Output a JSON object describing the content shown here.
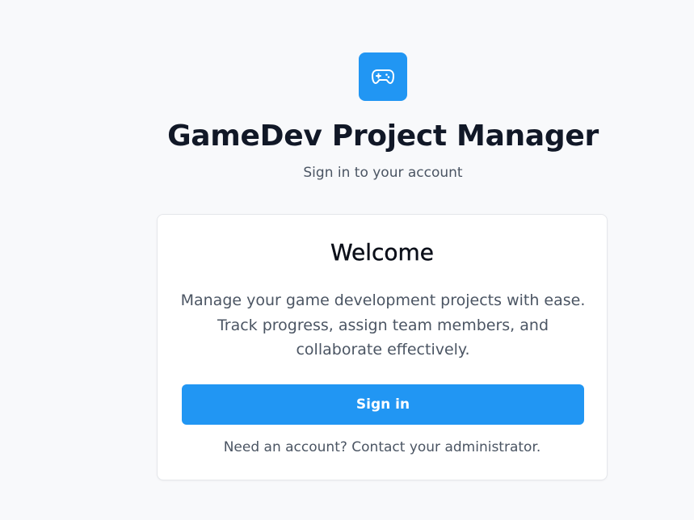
{
  "header": {
    "logo_icon": "gamepad-icon",
    "title": "GameDev Project Manager",
    "subtitle": "Sign in to your account"
  },
  "card": {
    "title": "Welcome",
    "description": "Manage your game development projects with ease. Track progress, assign team members, and collaborate effectively.",
    "signin_label": "Sign in",
    "help_text": "Need an account? Contact your administrator."
  },
  "colors": {
    "accent": "#2196f3",
    "background": "#f8f9fb",
    "card": "#ffffff",
    "text_primary": "#111827",
    "text_secondary": "#4b5563"
  }
}
